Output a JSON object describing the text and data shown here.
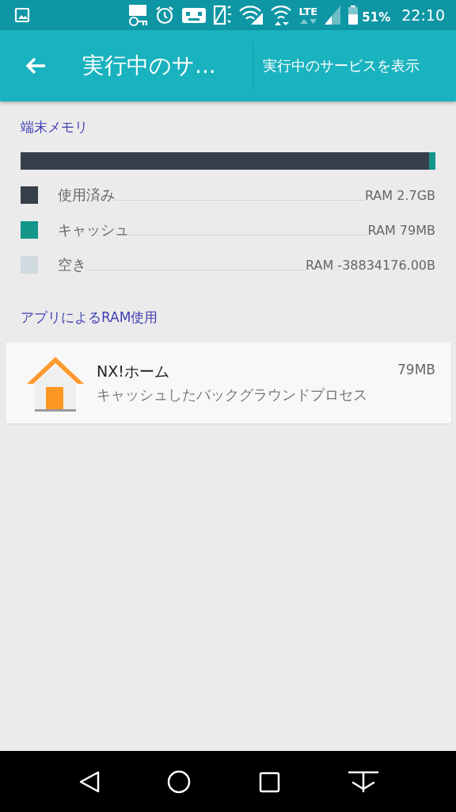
{
  "status_bar": {
    "network": "LTE",
    "battery": "51%",
    "time": "22:10"
  },
  "app_bar": {
    "title": "実行中のサ...",
    "action": "実行中のサービスを表示"
  },
  "memory": {
    "heading": "端末メモリ",
    "bar": [
      {
        "level": 0.984,
        "color": "#37404a"
      },
      {
        "level": 0.016,
        "color": "#14968a"
      }
    ],
    "legend": [
      {
        "label": "使用済み",
        "value": "RAM 2.7GB",
        "color": "#37404a"
      },
      {
        "label": "キャッシュ",
        "value": "RAM 79MB",
        "color": "#14968a"
      },
      {
        "label": "空き",
        "value": "RAM -38834176.00B",
        "color": "#d0d9de"
      }
    ]
  },
  "apps": {
    "heading": "アプリによるRAM使用",
    "items": [
      {
        "name": "NX!ホーム",
        "size": "79MB",
        "subtitle": "キャッシュしたバックグラウンドプロセス"
      }
    ]
  }
}
